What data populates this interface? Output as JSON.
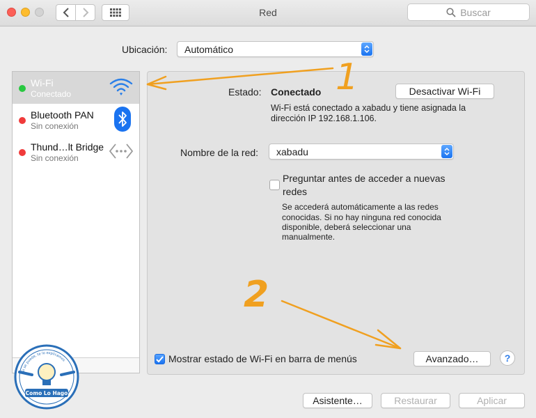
{
  "window": {
    "title": "Red"
  },
  "search": {
    "placeholder": "Buscar"
  },
  "location": {
    "label": "Ubicación:",
    "value": "Automático"
  },
  "services": [
    {
      "name": "Wi-Fi",
      "status": "Conectado",
      "status_color": "#28c840",
      "icon": "wifi-icon",
      "selected": true
    },
    {
      "name": "Bluetooth PAN",
      "status": "Sin conexión",
      "status_color": "#f03b3b",
      "icon": "bluetooth-icon",
      "selected": false
    },
    {
      "name": "Thund…lt Bridge",
      "status": "Sin conexión",
      "status_color": "#f03b3b",
      "icon": "thunderbolt-bridge-icon",
      "selected": false
    }
  ],
  "status": {
    "label": "Estado:",
    "value": "Conectado",
    "description_line1": "Wi-Fi está conectado a xabadu y tiene asignada la",
    "description_line2": "dirección IP 192.168.1.106.",
    "toggle_button": "Desactivar Wi-Fi"
  },
  "network": {
    "label": "Nombre de la red:",
    "value": "xabadu"
  },
  "ask_join": {
    "checked": false,
    "label_line1": "Preguntar antes de acceder a nuevas",
    "label_line2": "redes",
    "help_line1": "Se accederá automáticamente a las redes",
    "help_line2": "conocidas. Si no hay ninguna red conocida",
    "help_line3": "disponible, deberá seleccionar una",
    "help_line4": "manualmente."
  },
  "menu_bar": {
    "checked": true,
    "label": "Mostrar estado de Wi-Fi en barra de menús"
  },
  "buttons": {
    "advanced": "Avanzado…",
    "help": "?",
    "assistant": "Asistente…",
    "revert": "Restaurar",
    "apply": "Aplicar"
  },
  "annotations": {
    "one": "1",
    "two": "2"
  },
  "watermark": {
    "name": "Como Lo Hago",
    "tagline": "Si se puede, te lo explicamos"
  },
  "colors": {
    "accent": "#1a73f0",
    "annotation": "#f0a020",
    "selected_row": "#d8d8d8"
  }
}
